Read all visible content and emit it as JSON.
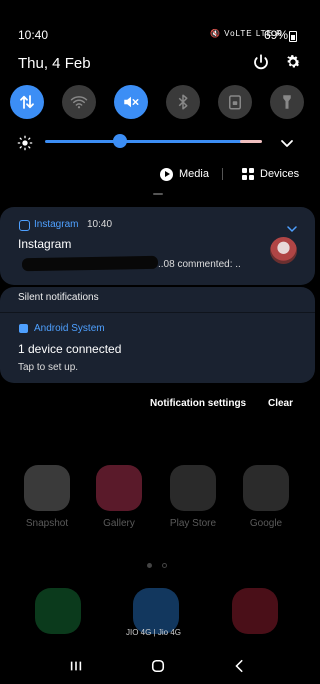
{
  "status_bar": {
    "time": "10:40",
    "indicators": "🔇 VoLTE LTE R",
    "battery_pct": "69%",
    "date": "Thu, 4 Feb"
  },
  "quick_settings": [
    {
      "name": "mobile-data",
      "on": true
    },
    {
      "name": "wifi",
      "on": false
    },
    {
      "name": "sound",
      "on": true
    },
    {
      "name": "bluetooth",
      "on": false
    },
    {
      "name": "screen-lock",
      "on": false
    },
    {
      "name": "flashlight",
      "on": false
    }
  ],
  "brightness": {
    "level": 0.32
  },
  "media": {
    "media_label": "Media",
    "devices_label": "Devices"
  },
  "notifications": {
    "instagram": {
      "app": "Instagram",
      "time": "10:40",
      "title": "Instagram",
      "body": "..08 commented: .."
    },
    "silent": {
      "header": "Silent notifications",
      "app": "Android System",
      "title": "1 device connected",
      "subtitle": "Tap to set up."
    }
  },
  "actions": {
    "settings": "Notification settings",
    "clear": "Clear"
  },
  "home": {
    "apps": [
      {
        "label": "Snapshot"
      },
      {
        "label": "Gallery"
      },
      {
        "label": "Play Store"
      },
      {
        "label": "Google"
      }
    ],
    "carrier": "JIO 4G | Jio 4G"
  },
  "colors": {
    "accent": "#3c8ef5",
    "card": "#1a2230",
    "app_name": "#4ea0ff"
  }
}
